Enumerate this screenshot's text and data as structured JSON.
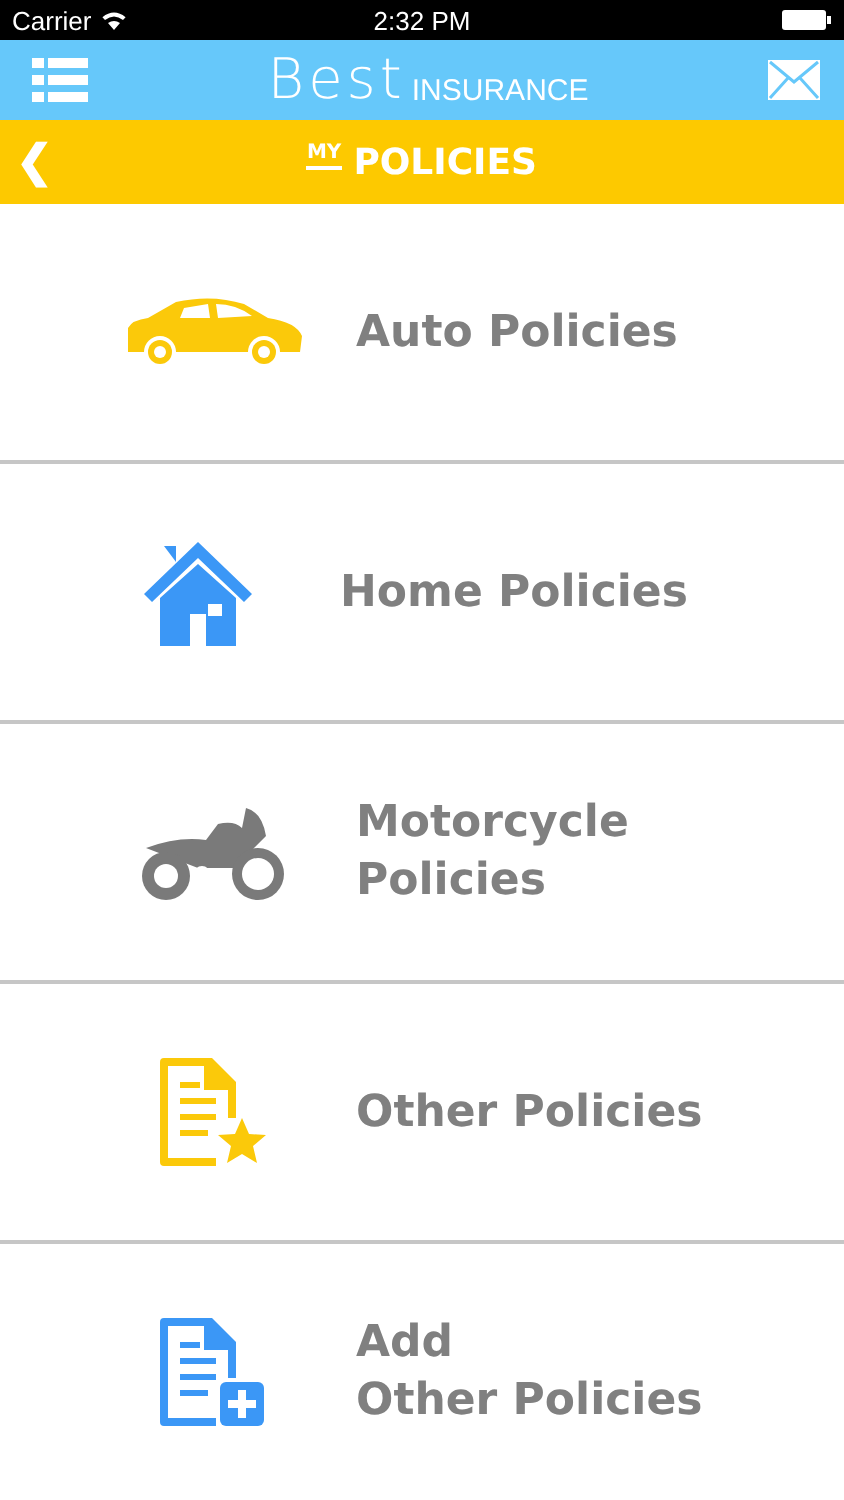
{
  "status_bar": {
    "carrier": "Carrier",
    "time": "2:32 PM"
  },
  "header": {
    "logo_main": "Best",
    "logo_sub": "INSURANCE"
  },
  "title_bar": {
    "prefix": "MY",
    "title": "POLICIES",
    "back": "❮"
  },
  "policies": [
    {
      "kind": "car",
      "color": "#fbc90a",
      "label": "Auto Policies"
    },
    {
      "kind": "house",
      "color": "#3b97f6",
      "label": "Home Policies"
    },
    {
      "kind": "motorcycle",
      "color": "#7a7a7a",
      "label": "Motorcycle\nPolicies"
    },
    {
      "kind": "doc-star",
      "color": "#fbc90a",
      "label": "Other Policies"
    },
    {
      "kind": "doc-plus",
      "color": "#3b97f6",
      "label": "Add\nOther Policies"
    }
  ]
}
